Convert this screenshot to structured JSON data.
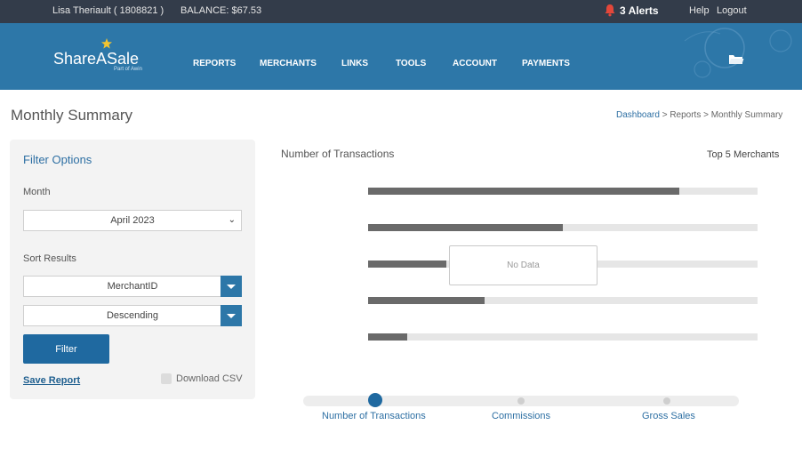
{
  "topbar": {
    "user": "Lisa Theriault ( 1808821 )",
    "balance": "BALANCE: $67.53",
    "alerts": "3 Alerts",
    "help": "Help",
    "logout": "Logout"
  },
  "brand": {
    "name": "ShareASale",
    "sub": "Part of Awin"
  },
  "nav": [
    "REPORTS",
    "MERCHANTS",
    "LINKS",
    "TOOLS",
    "ACCOUNT",
    "PAYMENTS"
  ],
  "page": {
    "title": "Monthly Summary"
  },
  "breadcrumb": {
    "dashboard": "Dashboard",
    "rest": " > Reports > Monthly Summary"
  },
  "filter": {
    "title": "Filter Options",
    "month_label": "Month",
    "month_value": "April 2023",
    "sort_label": "Sort Results",
    "sort_by": "MerchantID",
    "sort_order": "Descending",
    "filter_button": "Filter",
    "save_report": "Save Report",
    "download_csv": "Download CSV"
  },
  "chart": {
    "title": "Number of Transactions",
    "top5": "Top 5 Merchants",
    "no_data": "No Data",
    "bar_fill_fractions": [
      0.8,
      0.5,
      0.2,
      0.3,
      0.1
    ]
  },
  "tabs": [
    "Number of Transactions",
    "Commissions",
    "Gross Sales"
  ],
  "colors": {
    "topbar": "#333c4a",
    "header": "#2d77a8",
    "accent": "#1f69a0",
    "bell": "#e3473a"
  }
}
